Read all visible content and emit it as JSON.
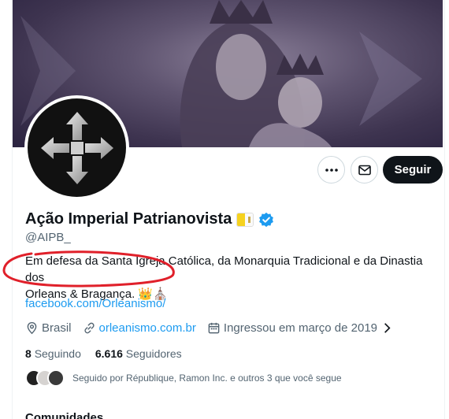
{
  "profile": {
    "display_name": "Ação Imperial Patrianovista",
    "handle": "@AIPB_",
    "bio_line1": "Em defesa da Santa Igreja Católica, da Monarquia Tradicional e da Dinastia dos",
    "bio_line2": "Orleans & Bragança. 👑⛪",
    "website_link": "facebook.com/Orleanismo/",
    "location": "Brasil",
    "url": "orleanismo.com.br",
    "joined": "Ingressou em março de 2019",
    "following_count": "8",
    "following_label": "Seguindo",
    "followers_count": "6.616",
    "followers_label": "Seguidores",
    "followed_by": "Seguido por République, Ramon Inc. e outros 3 que você segue"
  },
  "actions": {
    "follow_label": "Seguir",
    "more_icon": "more-icon",
    "message_icon": "envelope-icon"
  },
  "sections": {
    "communities_label": "Comunidades"
  },
  "colors": {
    "accent": "#1d9bf0",
    "text": "#0f1419",
    "secondary": "#536471",
    "annotation": "#e0202a"
  }
}
